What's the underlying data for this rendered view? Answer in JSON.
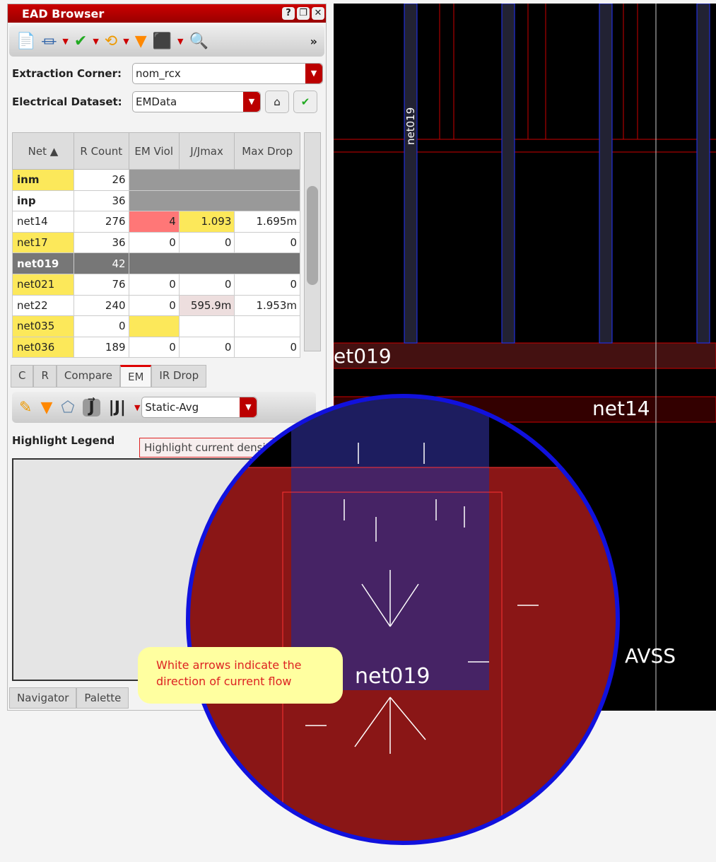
{
  "window": {
    "title": "EAD Browser",
    "buttons": [
      "?",
      "❐",
      "✕"
    ]
  },
  "toolbar": {
    "overflow": "»"
  },
  "form": {
    "corner_label": "Extraction Corner:",
    "corner_value": "nom_rcx",
    "dataset_label": "Electrical Dataset:",
    "dataset_value": "EMData"
  },
  "table": {
    "headers": [
      "Net ▲",
      "R Count",
      "EM Viol",
      "J/Jmax",
      "Max Drop"
    ],
    "rows": [
      [
        "inm",
        "26",
        "",
        "",
        ""
      ],
      [
        "inp",
        "36",
        "",
        "",
        ""
      ],
      [
        "net14",
        "276",
        "4",
        "1.093",
        "1.695m"
      ],
      [
        "net17",
        "36",
        "0",
        "0",
        "0"
      ],
      [
        "net019",
        "42",
        "",
        "",
        ""
      ],
      [
        "net021",
        "76",
        "0",
        "0",
        "0"
      ],
      [
        "net22",
        "240",
        "0",
        "595.9m",
        "1.953m"
      ],
      [
        "net035",
        "0",
        "",
        "",
        ""
      ],
      [
        "net036",
        "189",
        "0",
        "0",
        "0"
      ]
    ]
  },
  "tabs": [
    "C",
    "R",
    "Compare",
    "EM",
    "IR Drop"
  ],
  "em": {
    "mode_value": "Static-Avg",
    "jvec": "J⃗",
    "jmag": "|J|"
  },
  "legend": {
    "title": "Highlight Legend"
  },
  "tooltip": "Highlight current density",
  "bottom_tabs": [
    "Navigator",
    "Palette"
  ],
  "layout": {
    "net_label": "net019",
    "net14": "net14",
    "avss": "AVSS",
    "bus_label": "et019"
  },
  "callout": "White arrows indicate the direction of current flow"
}
